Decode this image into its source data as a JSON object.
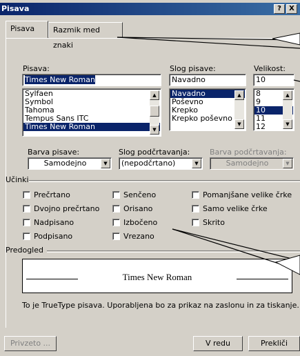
{
  "window": {
    "title": "Pisava",
    "help_label": "?",
    "close_label": "X"
  },
  "tabs": [
    {
      "label": "Pisava"
    },
    {
      "label": "Razmik med znaki"
    }
  ],
  "font": {
    "label": "Pisava:",
    "value": "Times New Roman",
    "items": [
      "Sylfaen",
      "Symbol",
      "Tahoma",
      "Tempus Sans ITC",
      "Times New Roman"
    ],
    "selected_index": 4
  },
  "style": {
    "label": "Slog pisave:",
    "value": "Navadno",
    "items": [
      "Navadno",
      "Poševno",
      "Krepko",
      "Krepko poševno"
    ],
    "selected_index": 0
  },
  "size": {
    "label": "Velikost:",
    "value": "10",
    "items": [
      "8",
      "9",
      "10",
      "11",
      "12"
    ],
    "selected_index": 2
  },
  "color": {
    "label": "Barva pisave:",
    "value": "Samodejno"
  },
  "underline": {
    "label": "Slog podčrtavanja:",
    "value": "(nepodčrtano)"
  },
  "underline_color": {
    "label": "Barva podčrtavanja:",
    "value": "Samodejno"
  },
  "effects": {
    "label": "Učinki",
    "items": [
      "Prečrtano",
      "Dvojno prečrtano",
      "Nadpisano",
      "Podpisano",
      "Senčeno",
      "Orisano",
      "Izbočeno",
      "Vrezano",
      "Pomanjšane velike črke",
      "Samo velike črke",
      "Skrito"
    ]
  },
  "preview": {
    "label": "Predogled",
    "sample": "Times New Roman"
  },
  "info": "To je TrueType pisava. Uporabljena bo za prikaz na zaslonu in za tiskanje.",
  "buttons": {
    "default": "Privzeto ...",
    "ok": "V redu",
    "cancel": "Prekliči"
  }
}
